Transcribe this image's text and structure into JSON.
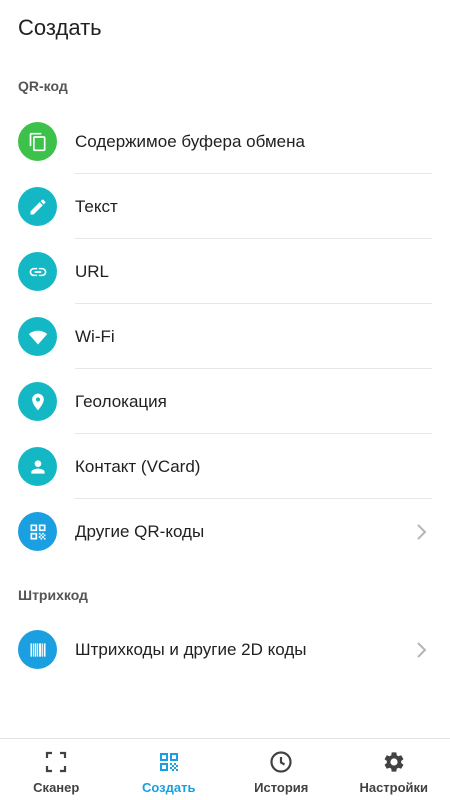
{
  "header": {
    "title": "Создать"
  },
  "sections": {
    "qr": {
      "title": "QR-код",
      "items": [
        {
          "label": "Содержимое буфера обмена",
          "icon": "clipboard-copy-icon",
          "color": "#3cc24a"
        },
        {
          "label": "Текст",
          "icon": "pencil-icon",
          "color": "#14b8c5"
        },
        {
          "label": "URL",
          "icon": "link-icon",
          "color": "#14b8c5"
        },
        {
          "label": "Wi-Fi",
          "icon": "wifi-icon",
          "color": "#14b8c5"
        },
        {
          "label": "Геолокация",
          "icon": "location-pin-icon",
          "color": "#14b8c5"
        },
        {
          "label": "Контакт (VCard)",
          "icon": "person-icon",
          "color": "#14b8c5"
        },
        {
          "label": "Другие QR-коды",
          "icon": "qr-code-icon",
          "color": "#1a9fe0"
        }
      ]
    },
    "barcode": {
      "title": "Штрихкод",
      "items": [
        {
          "label": "Штрихкоды и другие 2D коды",
          "icon": "barcode-icon",
          "color": "#1a9fe0"
        }
      ]
    }
  },
  "bottom_nav": {
    "active_color": "#1a9fe0",
    "items": [
      {
        "label": "Сканер",
        "icon": "scan-frame-icon"
      },
      {
        "label": "Создать",
        "icon": "qr-code-icon",
        "active": true
      },
      {
        "label": "История",
        "icon": "clock-icon"
      },
      {
        "label": "Настройки",
        "icon": "gear-icon"
      }
    ]
  }
}
